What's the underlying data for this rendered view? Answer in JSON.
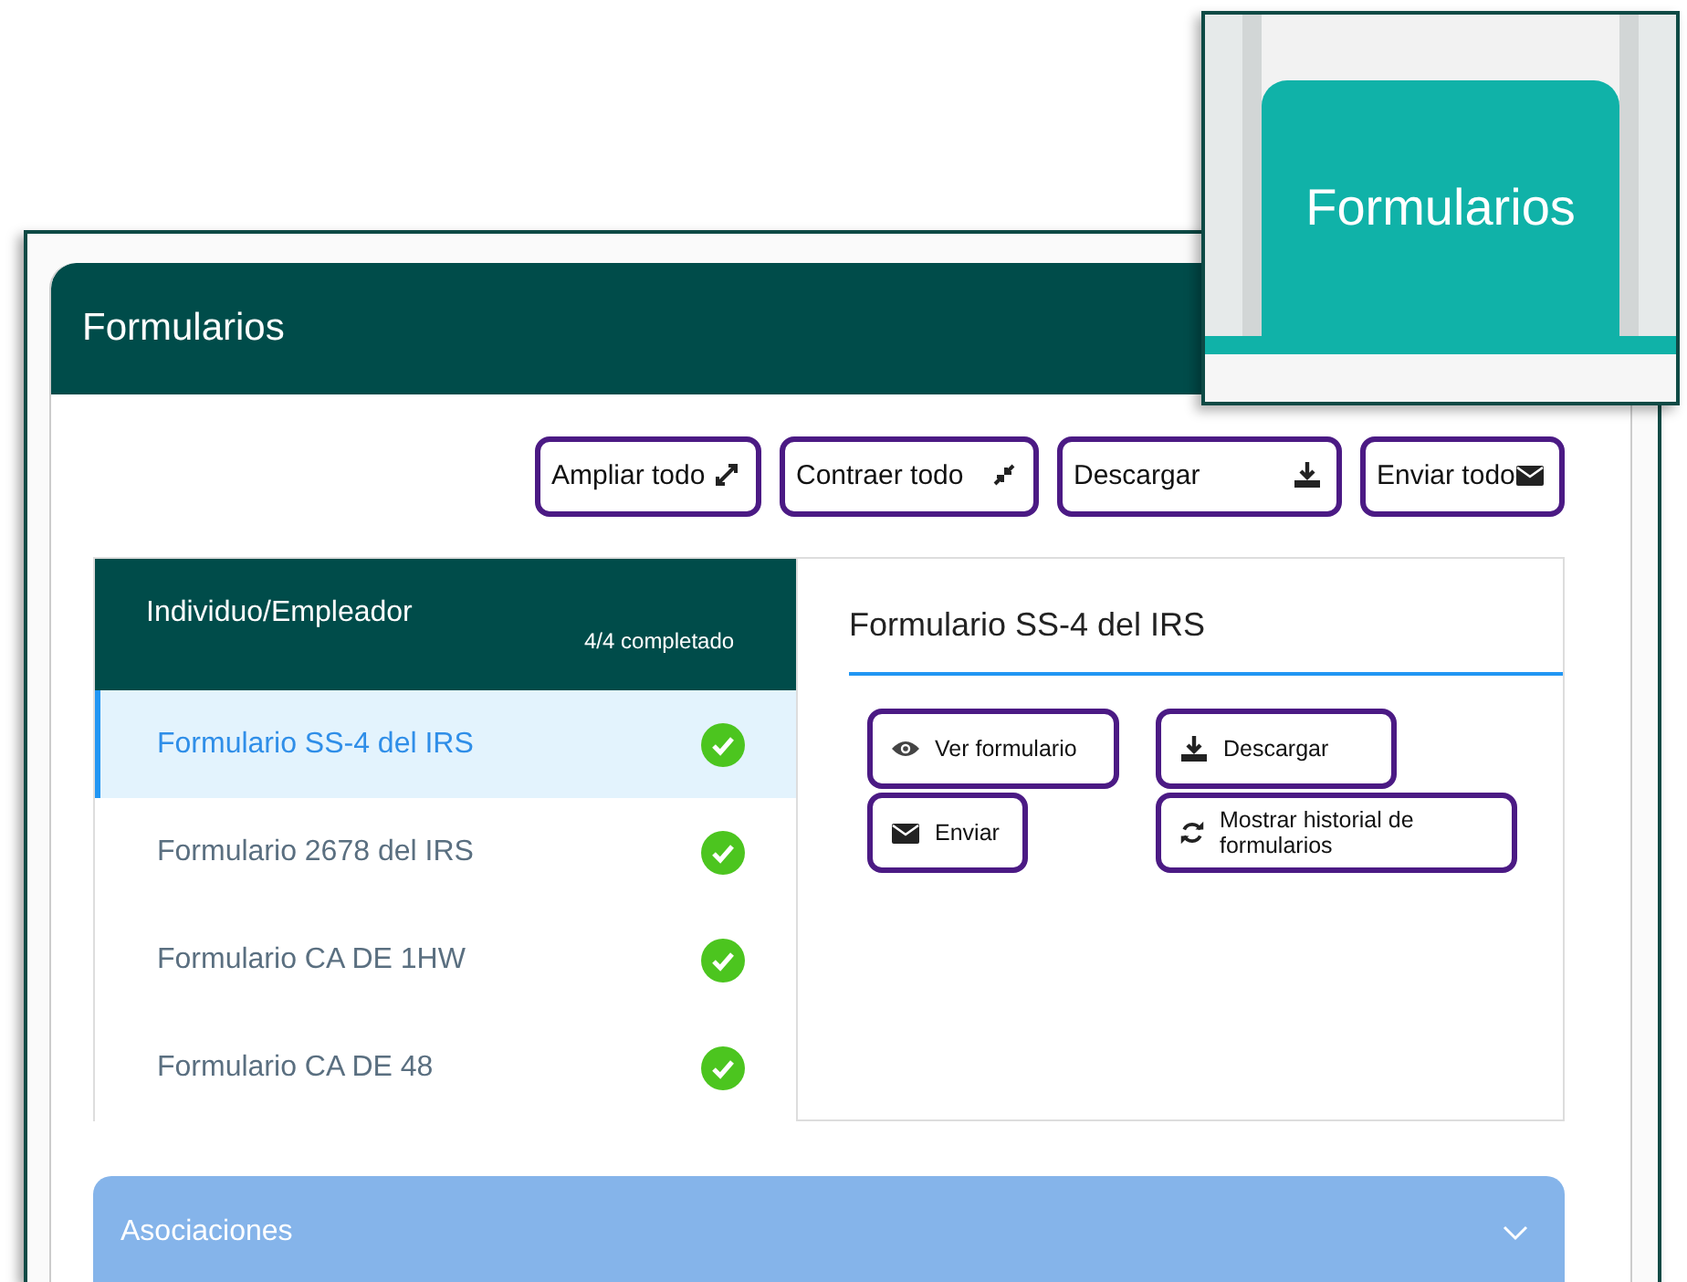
{
  "callout": {
    "tab_label": "Formularios"
  },
  "card": {
    "title": "Formularios"
  },
  "toolbar": [
    {
      "label": "Ampliar todo"
    },
    {
      "label": "Contraer todo"
    },
    {
      "label": "Descargar"
    },
    {
      "label": "Enviar todo"
    }
  ],
  "group": {
    "title": "Individuo/Empleador",
    "progress": "4/4 completado"
  },
  "forms": [
    {
      "name": "Formulario SS-4 del IRS",
      "selected": true,
      "complete": true
    },
    {
      "name": "Formulario 2678 del IRS",
      "selected": false,
      "complete": true
    },
    {
      "name": "Formulario CA DE 1HW",
      "selected": false,
      "complete": true
    },
    {
      "name": "Formulario CA DE 48",
      "selected": false,
      "complete": true
    }
  ],
  "detail": {
    "title": "Formulario SS-4 del IRS",
    "actions": [
      {
        "label": "Ver formulario"
      },
      {
        "label": "Descargar"
      },
      {
        "label": "Enviar"
      },
      {
        "label": "Mostrar historial de formularios"
      }
    ]
  },
  "accordion": {
    "title": "Asociaciones",
    "expanded": false
  }
}
